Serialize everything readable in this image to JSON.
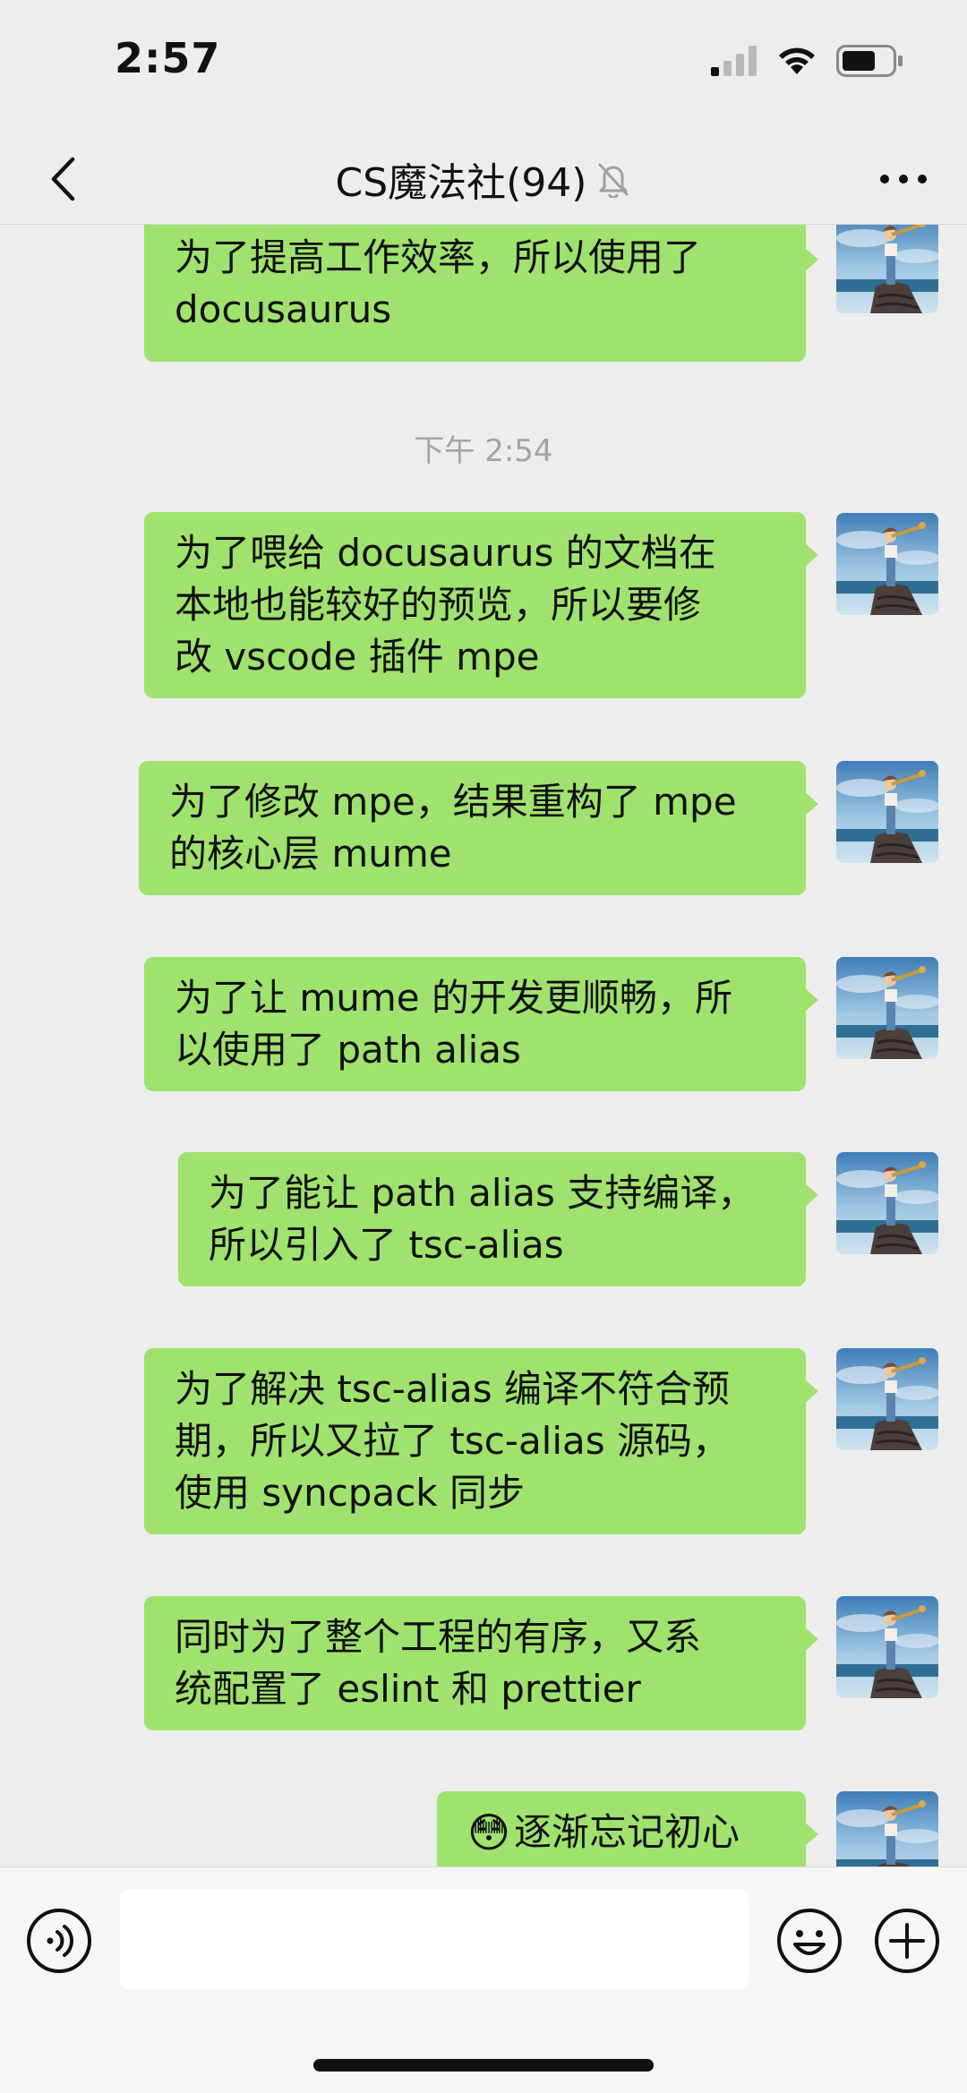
{
  "status_bar": {
    "time": "2:57"
  },
  "nav": {
    "title": "CS魔法社(94)"
  },
  "chat": {
    "time_divider": "下午 2:54",
    "messages": [
      {
        "lines": [
          "为了提高工作效率，所以使用了",
          "docusaurus"
        ]
      },
      {
        "lines": [
          "为了喂给 docusaurus 的文档在",
          "本地也能较好的预览，所以要修",
          "改 vscode 插件 mpe"
        ]
      },
      {
        "lines": [
          "为了修改 mpe，结果重构了 mpe",
          "的核心层 mume"
        ]
      },
      {
        "lines": [
          "为了让 mume 的开发更顺畅，所",
          "以使用了 path alias"
        ]
      },
      {
        "lines": [
          "为了能让 path alias 支持编译，",
          "所以引入了 tsc-alias"
        ]
      },
      {
        "lines": [
          "为了解决 tsc-alias 编译不符合预",
          "期，所以又拉了 tsc-alias 源码，",
          "使用 syncpack 同步"
        ]
      },
      {
        "lines": [
          "同时为了整个工程的有序，又系",
          "统配置了 eslint 和 prettier"
        ]
      },
      {
        "emoji": "😳",
        "lines": [
          "逐渐忘记初心"
        ]
      }
    ]
  },
  "input": {
    "placeholder": ""
  },
  "colors": {
    "bubble": "#a0e26e",
    "background": "#ededed"
  }
}
